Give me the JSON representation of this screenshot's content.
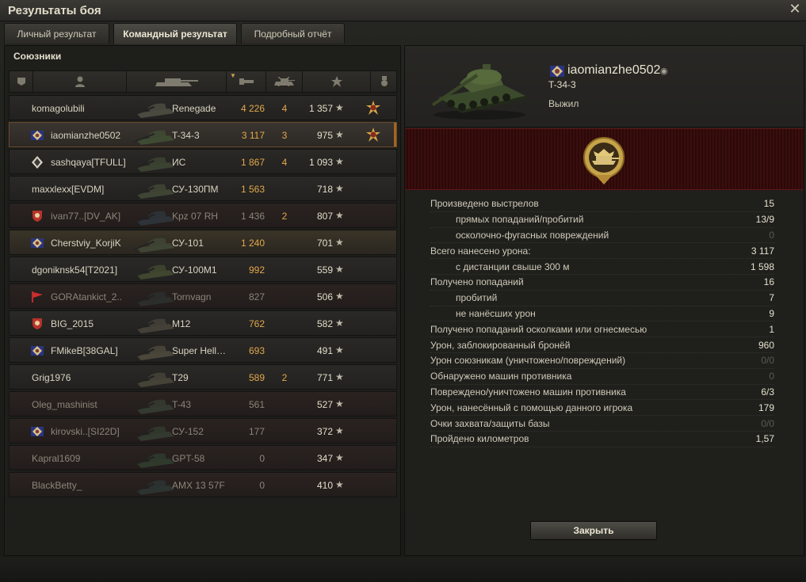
{
  "window": {
    "title": "Результаты боя",
    "close_glyph": "✕"
  },
  "tabs": [
    {
      "label": "Личный результат",
      "active": false
    },
    {
      "label": "Командный результат",
      "active": true
    },
    {
      "label": "Подробный отчёт",
      "active": false
    }
  ],
  "allies": {
    "title": "Союзники",
    "columns": [
      "squad-icon",
      "player-icon",
      "vehicle-icon",
      "damage-icon",
      "kills-icon",
      "xp-star-icon",
      "medal-icon"
    ],
    "rows": [
      {
        "name": "komagolubili",
        "vehicle": "Renegade",
        "damage": "4 226",
        "kills": "4",
        "xp": "1 357",
        "medal": true,
        "icon": "",
        "state": "alive"
      },
      {
        "name": "iaomianzhe0502",
        "vehicle": "T-34-3",
        "damage": "3 117",
        "kills": "3",
        "xp": "975",
        "medal": true,
        "icon": "clan",
        "state": "player"
      },
      {
        "name": "sashqaya[TFULL]",
        "vehicle": "ИС",
        "damage": "1 867",
        "kills": "4",
        "xp": "1 093",
        "medal": false,
        "icon": "diamond",
        "state": "alive"
      },
      {
        "name": "maxxlexx[EVDM]",
        "vehicle": "СУ-130ПМ",
        "damage": "1 563",
        "kills": "",
        "xp": "718",
        "medal": false,
        "icon": "",
        "state": "alive"
      },
      {
        "name": "ivan77..[DV_AK]",
        "vehicle": "Kpz 07 RH",
        "damage": "1 436",
        "kills": "2",
        "xp": "807",
        "medal": false,
        "icon": "shield",
        "state": "dead"
      },
      {
        "name": "Cherstviy_KorjiK",
        "vehicle": "СУ-101",
        "damage": "1 240",
        "kills": "",
        "xp": "701",
        "medal": false,
        "icon": "clan",
        "state": "squad"
      },
      {
        "name": "dgoniknsk54[T2021]",
        "vehicle": "СУ-100М1",
        "damage": "992",
        "kills": "",
        "xp": "559",
        "medal": false,
        "icon": "",
        "state": "alive"
      },
      {
        "name": "GORAtankict_2..",
        "vehicle": "Tornvagn",
        "damage": "827",
        "kills": "",
        "xp": "506",
        "medal": false,
        "icon": "flag",
        "state": "dead"
      },
      {
        "name": "BIG_2015",
        "vehicle": "M12",
        "damage": "762",
        "kills": "",
        "xp": "582",
        "medal": false,
        "icon": "shield",
        "state": "alive"
      },
      {
        "name": "FMikeB[38GAL]",
        "vehicle": "Super Hell…",
        "damage": "693",
        "kills": "",
        "xp": "491",
        "medal": false,
        "icon": "clan",
        "state": "alive"
      },
      {
        "name": "Grig1976",
        "vehicle": "T29",
        "damage": "589",
        "kills": "2",
        "xp": "771",
        "medal": false,
        "icon": "",
        "state": "alive"
      },
      {
        "name": "Oleg_mashinist",
        "vehicle": "T-43",
        "damage": "561",
        "kills": "",
        "xp": "527",
        "medal": false,
        "icon": "",
        "state": "dead"
      },
      {
        "name": "kirovski..[SI22D]",
        "vehicle": "СУ-152",
        "damage": "177",
        "kills": "",
        "xp": "372",
        "medal": false,
        "icon": "clan",
        "state": "dead"
      },
      {
        "name": "Kapral1609",
        "vehicle": "GPT-58",
        "damage": "0",
        "kills": "",
        "xp": "347",
        "medal": false,
        "icon": "",
        "state": "dead"
      },
      {
        "name": "BlackBetty_",
        "vehicle": "AMX 13 57F",
        "damage": "0",
        "kills": "",
        "xp": "410",
        "medal": false,
        "icon": "",
        "state": "dead"
      }
    ]
  },
  "detail": {
    "player_name": "iaomianzhe0502",
    "tank": "T-34-3",
    "status": "Выжил",
    "stats": [
      {
        "label": "Произведено выстрелов",
        "value": "15",
        "sub": false,
        "dim": false
      },
      {
        "label": "прямых попаданий/пробитий",
        "value": "13/9",
        "sub": true,
        "dim": false
      },
      {
        "label": "осколочно-фугасных повреждений",
        "value": "0",
        "sub": true,
        "dim": true
      },
      {
        "label": "Всего нанесено урона:",
        "value": "3 117",
        "sub": false,
        "dim": false
      },
      {
        "label": "с дистанции свыше 300 м",
        "value": "1 598",
        "sub": true,
        "dim": false
      },
      {
        "label": "Получено попаданий",
        "value": "16",
        "sub": false,
        "dim": false
      },
      {
        "label": "пробитий",
        "value": "7",
        "sub": true,
        "dim": false
      },
      {
        "label": "не нанёсших урон",
        "value": "9",
        "sub": true,
        "dim": false
      },
      {
        "label": "Получено попаданий осколками или огнесмесью",
        "value": "1",
        "sub": false,
        "dim": false
      },
      {
        "label": "Урон, заблокированный бронёй",
        "value": "960",
        "sub": false,
        "dim": false
      },
      {
        "label": "Урон союзникам (уничтожено/повреждений)",
        "value": "0/0",
        "sub": false,
        "dim": true
      },
      {
        "label": "Обнаружено машин противника",
        "value": "0",
        "sub": false,
        "dim": true
      },
      {
        "label": "Повреждено/уничтожено машин противника",
        "value": "6/3",
        "sub": false,
        "dim": false
      },
      {
        "label": "Урон, нанесённый с помощью данного игрока",
        "value": "179",
        "sub": false,
        "dim": false
      },
      {
        "label": "Очки захвата/защиты базы",
        "value": "0/0",
        "sub": false,
        "dim": true
      },
      {
        "label": "Пройдено километров",
        "value": "1,57",
        "sub": false,
        "dim": false
      }
    ],
    "close_label": "Закрыть"
  },
  "colors": {
    "accent_damage": "#e2a84a",
    "player_highlight": "#a5651f",
    "banner_red": "#3a0e0e"
  }
}
